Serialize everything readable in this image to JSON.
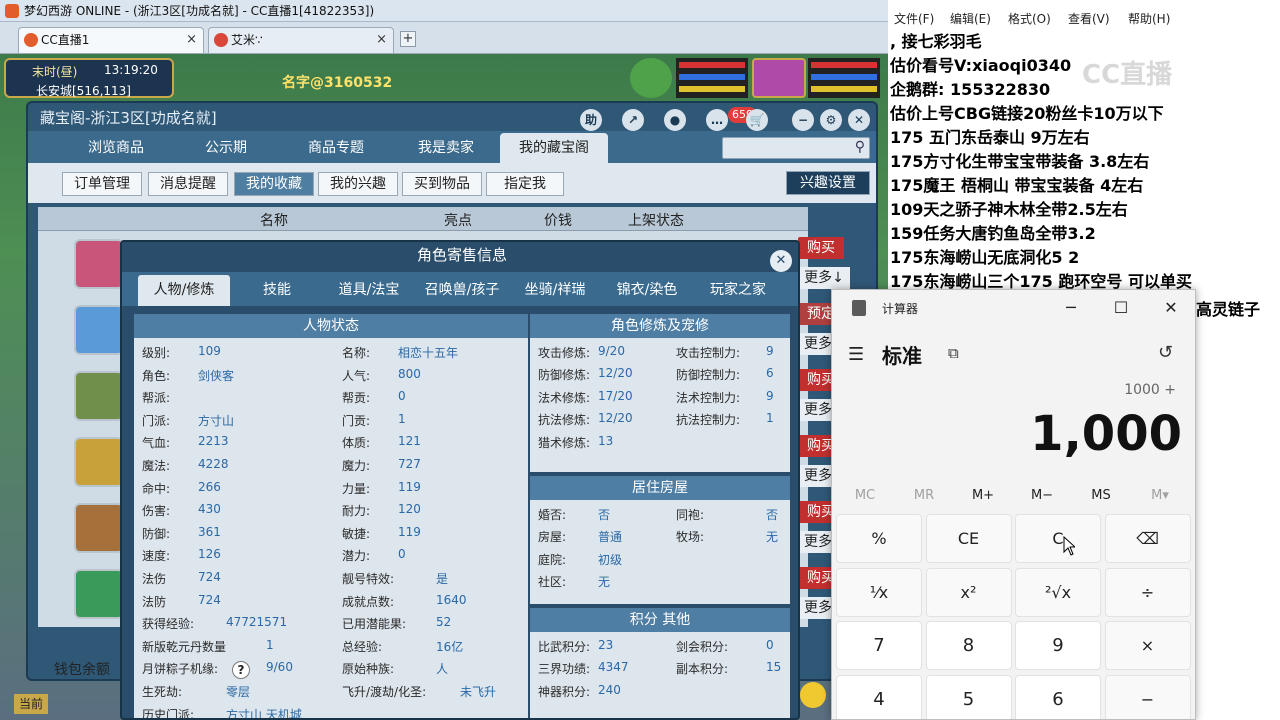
{
  "game_window": {
    "title": "梦幻西游 ONLINE - (浙江3区[功成名就] - CC直播1[41822353])",
    "tabs": [
      {
        "label": "CC直播1",
        "close": "×"
      },
      {
        "label": "艾米∵",
        "close": "×"
      }
    ],
    "new_tab": "+",
    "hud": {
      "time": "末时(昼)",
      "clock": "13:19:20",
      "location": "长安城[516,113]"
    },
    "player_name": "名字@3160532"
  },
  "store": {
    "title": "藏宝阁-浙江3区[功成名就]",
    "help": "助",
    "badge": "659",
    "nav_tabs": [
      "浏览商品",
      "公示期",
      "商品专题",
      "我是卖家",
      "我的藏宝阁"
    ],
    "active_nav": 4,
    "sub_tabs": [
      "订单管理",
      "消息提醒",
      "我的收藏",
      "我的兴趣",
      "买到物品",
      "指定我"
    ],
    "active_sub": 2,
    "interest_button": "兴趣设置",
    "table_headers": [
      "名称",
      "亮点",
      "价钱",
      "上架状态"
    ],
    "buy_label": "购买",
    "more_label": "更多",
    "more_arrow_label": "更多↓",
    "preorder_label": "预定",
    "wallet_label": "钱包余额"
  },
  "info_dialog": {
    "title": "角色寄售信息",
    "tabs": [
      "人物/修炼",
      "技能",
      "道具/法宝",
      "召唤兽/孩子",
      "坐骑/祥瑞",
      "锦衣/染色",
      "玩家之家"
    ],
    "active_tab": 0,
    "status_panel": {
      "heading": "人物状态",
      "left": [
        {
          "k": "级别:",
          "v": "109"
        },
        {
          "k": "角色:",
          "v": "剑侠客"
        },
        {
          "k": "帮派:",
          "v": ""
        },
        {
          "k": "门派:",
          "v": "方寸山"
        },
        {
          "k": "气血:",
          "v": "2213"
        },
        {
          "k": "魔法:",
          "v": "4228"
        },
        {
          "k": "命中:",
          "v": "266"
        },
        {
          "k": "伤害:",
          "v": "430"
        },
        {
          "k": "防御:",
          "v": "361"
        },
        {
          "k": "速度:",
          "v": "126"
        },
        {
          "k": "法伤",
          "v": "724"
        },
        {
          "k": "法防",
          "v": "724"
        },
        {
          "k": "获得经验:",
          "v": "47721571"
        },
        {
          "k": "新版乾元丹数量",
          "v": "1"
        },
        {
          "k": "月饼粽子机缘:",
          "v": "9/60"
        },
        {
          "k": "生死劫:",
          "v": "零层"
        },
        {
          "k": "历史门派:",
          "v": "方寸山 天机城"
        }
      ],
      "right": [
        {
          "k": "名称:",
          "v": "相恋十五年"
        },
        {
          "k": "人气:",
          "v": "800"
        },
        {
          "k": "帮贡:",
          "v": "0"
        },
        {
          "k": "门贡:",
          "v": "1"
        },
        {
          "k": "体质:",
          "v": "121"
        },
        {
          "k": "魔力:",
          "v": "727"
        },
        {
          "k": "力量:",
          "v": "119"
        },
        {
          "k": "耐力:",
          "v": "120"
        },
        {
          "k": "敏捷:",
          "v": "119"
        },
        {
          "k": "潜力:",
          "v": "0"
        },
        {
          "k": "靓号特效:",
          "v": "是"
        },
        {
          "k": "成就点数:",
          "v": "1640"
        },
        {
          "k": "已用潜能果:",
          "v": "52"
        },
        {
          "k": "总经验:",
          "v": "16亿"
        },
        {
          "k": "原始种族:",
          "v": "人"
        },
        {
          "k": "飞升/渡劫/化圣:",
          "v": "未飞升"
        }
      ],
      "help_icon": "?"
    },
    "cultivation_panel": {
      "heading": "角色修炼及宠修",
      "rows": [
        {
          "k1": "攻击修炼:",
          "v1": "9/20",
          "k2": "攻击控制力:",
          "v2": "9"
        },
        {
          "k1": "防御修炼:",
          "v1": "12/20",
          "k2": "防御控制力:",
          "v2": "6"
        },
        {
          "k1": "法术修炼:",
          "v1": "17/20",
          "k2": "法术控制力:",
          "v2": "9"
        },
        {
          "k1": "抗法修炼:",
          "v1": "12/20",
          "k2": "抗法控制力:",
          "v2": "1"
        },
        {
          "k1": "猎术修炼:",
          "v1": "13",
          "k2": "",
          "v2": ""
        }
      ]
    },
    "housing_panel": {
      "heading": "居住房屋",
      "rows": [
        {
          "k1": "婚否:",
          "v1": "否",
          "k2": "同袍:",
          "v2": "否"
        },
        {
          "k1": "房屋:",
          "v1": "普通",
          "k2": "牧场:",
          "v2": "无"
        },
        {
          "k1": "庭院:",
          "v1": "初级",
          "k2": "",
          "v2": ""
        },
        {
          "k1": "社区:",
          "v1": "无",
          "k2": "",
          "v2": ""
        }
      ]
    },
    "points_panel": {
      "heading": "积分 其他",
      "rows": [
        {
          "k1": "比武积分:",
          "v1": "23",
          "k2": "剑会积分:",
          "v2": "0"
        },
        {
          "k1": "三界功绩:",
          "v1": "4347",
          "k2": "副本积分:",
          "v2": "15"
        },
        {
          "k1": "神器积分:",
          "v1": "240",
          "k2": "",
          "v2": ""
        }
      ]
    }
  },
  "notepad": {
    "menu": [
      "文件(F)",
      "编辑(E)",
      "格式(O)",
      "查看(V)",
      "帮助(H)"
    ],
    "lines": [
      ",      接七彩羽毛",
      "估价看号V:xiaoqi0340",
      "企鹅群: 155322830",
      "估价上号CBG链接20粉丝卡10万以下",
      "175 五门东岳泰山  9万左右",
      "175方寸化生带宝宝带装备  3.8左右",
      "175魔王 梧桐山  带宝宝装备 4左右",
      "109天之骄子神木林全带2.5左右",
      "159任务大唐钓鱼岛全带3.2",
      "175东海崂山无底洞化5  2",
      "175东海崂山三个175 跑环空号 可以单买"
    ],
    "overflow_text": "高灵链子",
    "watermark": "CC直播"
  },
  "calculator": {
    "title": "计算器",
    "mode": "标准",
    "expression": "1000 +",
    "display": "1,000",
    "memory": [
      "MC",
      "MR",
      "M+",
      "M−",
      "MS",
      "M▾"
    ],
    "keys": [
      [
        "%",
        "CE",
        "C",
        "⌫"
      ],
      [
        "¹⁄x",
        "x²",
        "²√x",
        "÷"
      ],
      [
        "7",
        "8",
        "9",
        "×"
      ],
      [
        "4",
        "5",
        "6",
        "−"
      ]
    ]
  }
}
